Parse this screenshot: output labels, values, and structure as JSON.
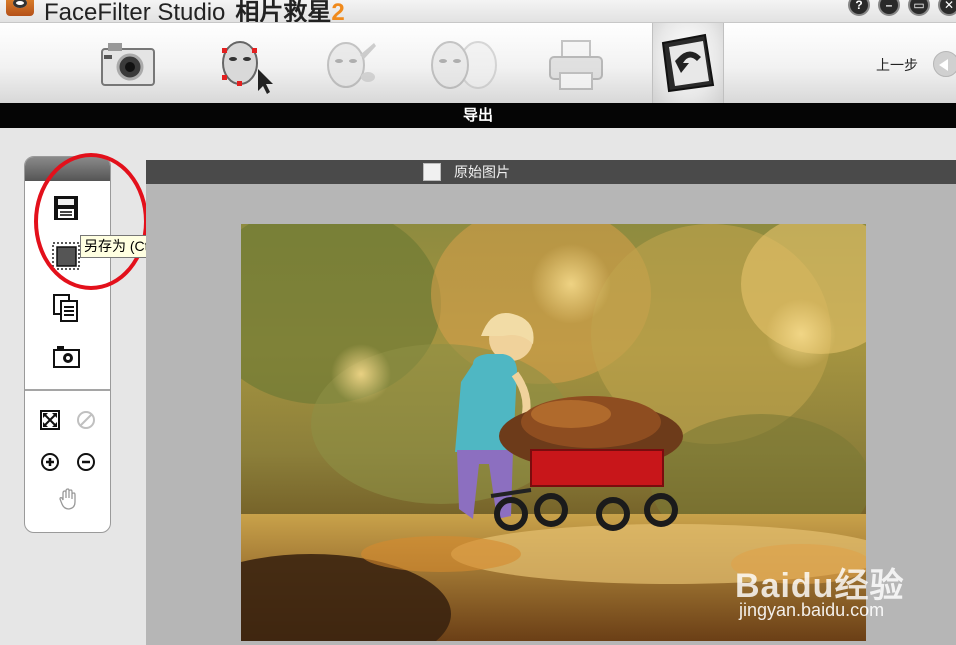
{
  "window": {
    "title_en": "FaceFilter Studio",
    "title_zh": "相片救星",
    "version": "2",
    "controls": {
      "help": "?",
      "minimize": "–",
      "restore": "▭",
      "close": "✕"
    }
  },
  "toolbar": {
    "tools": [
      {
        "name": "open-camera",
        "icon": "camera-icon"
      },
      {
        "name": "face-detect",
        "icon": "face-select-icon"
      },
      {
        "name": "face-edit",
        "icon": "face-brush-icon"
      },
      {
        "name": "face-morph",
        "icon": "face-morph-icon"
      },
      {
        "name": "print",
        "icon": "printer-icon"
      },
      {
        "name": "export",
        "icon": "export-icon"
      }
    ],
    "back_label": "上一步"
  },
  "section": {
    "title": "导出"
  },
  "left_panel": {
    "buttons": [
      "save-icon",
      "save-as-icon",
      "copy-icon",
      "camera-icon",
      "fit-icon",
      "cancel-icon",
      "zoom-in-icon",
      "zoom-out-icon",
      "hand-icon"
    ],
    "tooltip": "另存为 (Ctrl+A)"
  },
  "preview": {
    "label": "原始图片",
    "checkbox_checked": false
  },
  "watermark": {
    "brand": "Baidu",
    "brand_zh": "经验",
    "url": "jingyan.baidu.com"
  },
  "colors": {
    "accent_orange": "#f08a1c",
    "annotation_red": "#e3101b",
    "section_bar": "#050505",
    "wagon_red": "#c8161a",
    "shirt_teal": "#4fb7c3",
    "pants_purple": "#8c6fc0"
  }
}
